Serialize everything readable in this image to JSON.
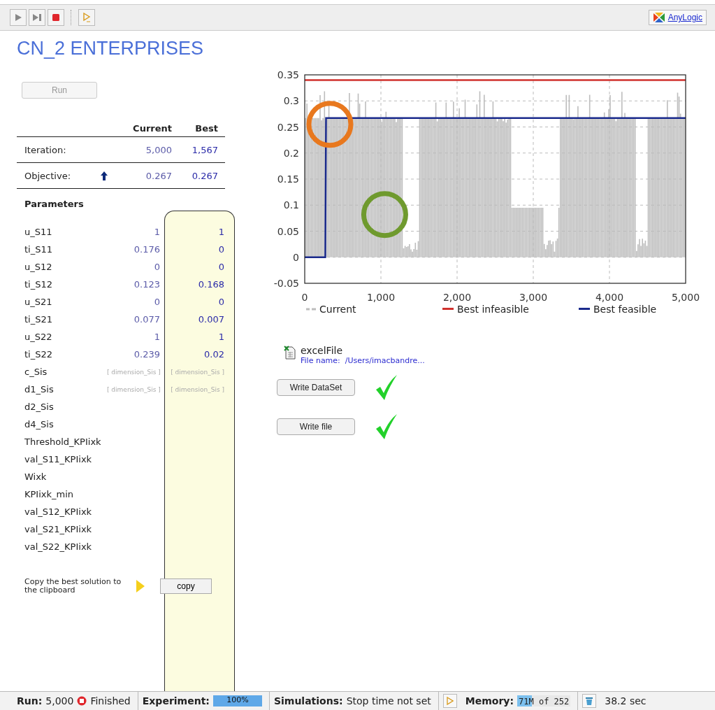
{
  "toolbar": {
    "logo": "AnyLogic"
  },
  "title": "CN_2 ENTERPRISES",
  "run_button": {
    "label": "Run",
    "disabled": true
  },
  "summary": {
    "columns": [
      "Current",
      "Best"
    ],
    "rows": [
      {
        "label": "Iteration:",
        "current": "5,000",
        "best": "1,567",
        "arrow": false
      },
      {
        "label": "Objective:",
        "current": "0.267",
        "best": "0.267",
        "arrow": true
      }
    ]
  },
  "parameters": {
    "heading": "Parameters",
    "rows": [
      {
        "name": "u_S11",
        "current": "1",
        "best": "1"
      },
      {
        "name": "ti_S11",
        "current": "0.176",
        "best": "0"
      },
      {
        "name": "u_S12",
        "current": "0",
        "best": "0"
      },
      {
        "name": "ti_S12",
        "current": "0.123",
        "best": "0.168"
      },
      {
        "name": "u_S21",
        "current": "0",
        "best": "0"
      },
      {
        "name": "ti_S21",
        "current": "0.077",
        "best": "0.007"
      },
      {
        "name": "u_S22",
        "current": "1",
        "best": "1"
      },
      {
        "name": "ti_S22",
        "current": "0.239",
        "best": "0.02"
      },
      {
        "name": "c_Sis",
        "current": "[ dimension_Sis ]",
        "best": "[ dimension_Sis ]"
      },
      {
        "name": "d1_Sis",
        "current": "[ dimension_Sis ]",
        "best": "[ dimension_Sis ]"
      },
      {
        "name": "d2_Sis"
      },
      {
        "name": "d4_Sis"
      },
      {
        "name": "Threshold_KPIixk"
      },
      {
        "name": "val_S11_KPIixk"
      },
      {
        "name": "Wixk"
      },
      {
        "name": "KPIixk_min"
      },
      {
        "name": "val_S12_KPIixk"
      },
      {
        "name": "val_S21_KPIixk"
      },
      {
        "name": "val_S22_KPIixk"
      }
    ]
  },
  "copy": {
    "text": "Copy the best solution to the clipboard",
    "button": "copy"
  },
  "current_trace": {
    "name": "Current",
    "color": "#bdbdbd"
  },
  "highlights": [
    {
      "color": "#e8781e"
    },
    {
      "color": "#6f9a2e"
    }
  ],
  "chart_data": {
    "type": "line",
    "x": [
      0,
      270,
      280,
      5000
    ],
    "xlim": [
      0,
      5000
    ],
    "ylim": [
      -0.05,
      0.35
    ],
    "grid": true,
    "legend": true,
    "xticks": [
      {
        "value": 0,
        "label": "0"
      },
      {
        "value": 1000,
        "label": "1,000"
      },
      {
        "value": 2000,
        "label": "2,000"
      },
      {
        "value": 3000,
        "label": "3,000"
      },
      {
        "value": 4000,
        "label": "4,000"
      },
      {
        "value": 5000,
        "label": "5,000"
      }
    ],
    "yticks": [
      {
        "value": 0.35,
        "label": "0.35"
      },
      {
        "value": 0.3,
        "label": "0.3"
      },
      {
        "value": 0.25,
        "label": "0.25"
      },
      {
        "value": 0.2,
        "label": "0.2"
      },
      {
        "value": 0.15,
        "label": "0.15"
      },
      {
        "value": 0.1,
        "label": "0.1"
      },
      {
        "value": 0.05,
        "label": "0.05"
      },
      {
        "value": 0,
        "label": "0"
      },
      {
        "value": -0.05,
        "label": "-0.05"
      }
    ],
    "series": [
      {
        "name": "Best infeasible",
        "color": "#d0312d",
        "values": [
          0.34,
          0.34,
          0.34,
          0.34
        ]
      },
      {
        "name": "Best feasible",
        "color": "#1a2a8c",
        "values": [
          0,
          0,
          0.267,
          0.267
        ]
      }
    ]
  },
  "excel": {
    "name": "excelFile",
    "file_label": "File name:",
    "file_path": "/Users/imacbandre..."
  },
  "actions": [
    {
      "label": "Write DataSet",
      "done": true
    },
    {
      "label": "Write file",
      "done": true
    }
  ],
  "status_bar": {
    "run_label": "Run:",
    "run_value": "5,000",
    "run_state": "Finished",
    "experiment": {
      "label": "Experiment:",
      "text": "100%",
      "level": 1
    },
    "simulations_label": "Simulations:",
    "simulations_value": "Stop time not set",
    "memory": {
      "label": "Memory:",
      "value": "71M of 252",
      "level": 0.28
    },
    "time": "38.2 sec"
  }
}
